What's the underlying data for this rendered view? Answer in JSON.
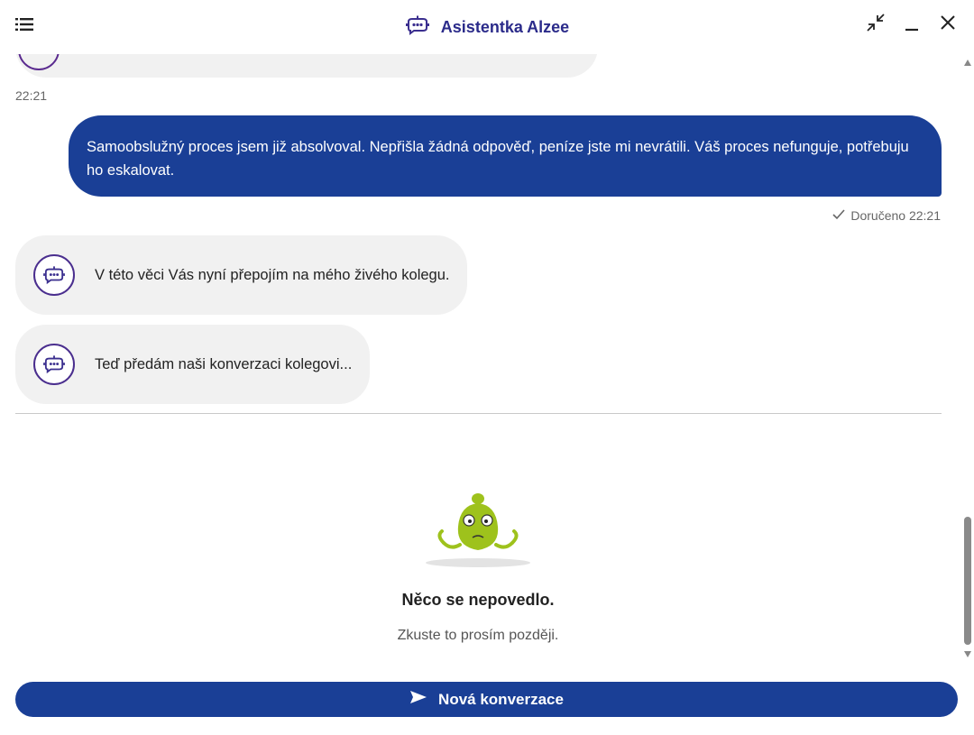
{
  "header": {
    "title": "Asistentka Alzee",
    "menu_icon": "menu-icon",
    "bot_icon": "bot-icon",
    "collapse_icon": "collapse-icon",
    "minimize_icon": "minimize-icon",
    "close_icon": "close-icon"
  },
  "chat": {
    "timestamp": "22:21",
    "user_message": "Samoobslužný proces jsem již absolvoval. Nepřišla žádná odpověď, peníze jste mi nevrátili. Váš proces nefunguje, potřebuju ho eskalovat.",
    "delivered_status": "Doručeno 22:21",
    "bot_messages": [
      {
        "text": "V této věci Vás nyní přepojím na mého živého kolegu."
      },
      {
        "text": "Teď předám naši konverzaci kolegovi..."
      }
    ]
  },
  "error": {
    "title": "Něco se nepovedlo.",
    "subtitle": "Zkuste to prosím později."
  },
  "footer": {
    "button_label": "Nová konverzace",
    "button_icon": "send-icon"
  },
  "colors": {
    "accent": "#1a3f96",
    "bot_bubble": "#f1f1f1",
    "title": "#2b2b8a",
    "mascot": "#9ec21c"
  }
}
